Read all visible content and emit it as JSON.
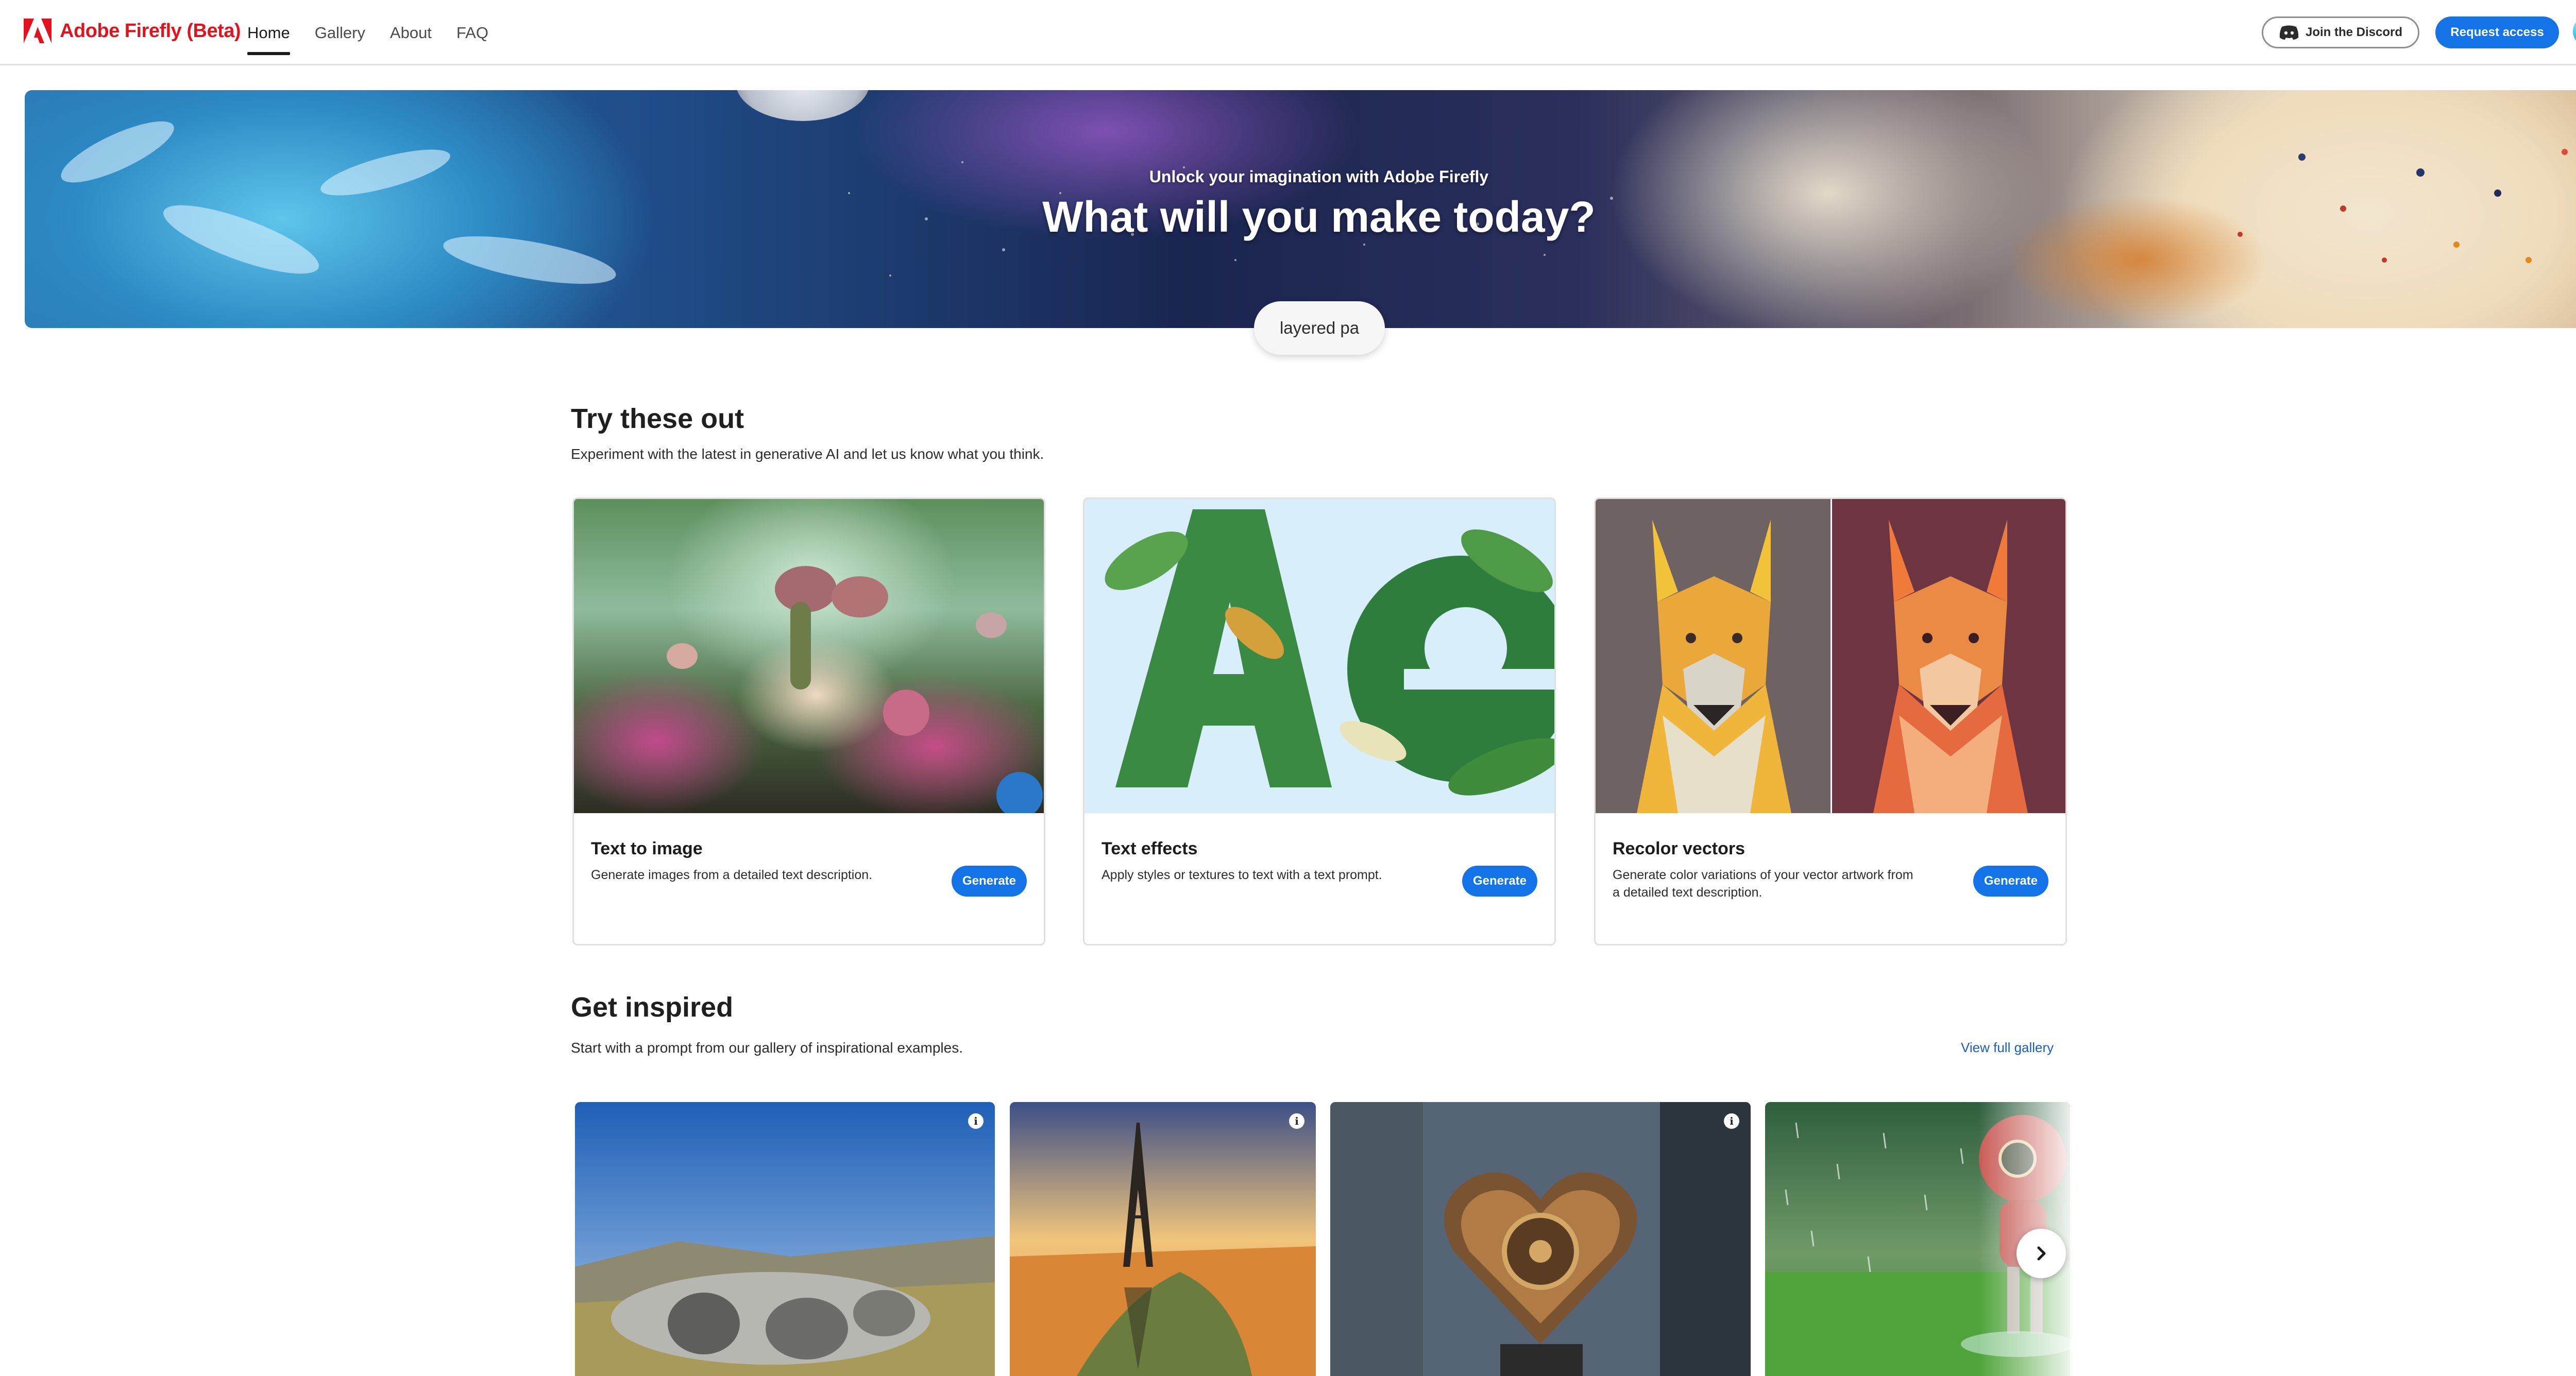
{
  "header": {
    "brand": "Adobe Firefly (Beta)",
    "nav": [
      {
        "label": "Home",
        "active": true
      },
      {
        "label": "Gallery",
        "active": false
      },
      {
        "label": "About",
        "active": false
      },
      {
        "label": "FAQ",
        "active": false
      }
    ],
    "discord_label": "Join the Discord",
    "request_label": "Request access",
    "brand_color": "#e0141e",
    "accent_color": "#1473e6"
  },
  "hero": {
    "subtitle": "Unlock your imagination with Adobe Firefly",
    "title": "What will you make today?",
    "prompt_text": "layered pa"
  },
  "try_section": {
    "title": "Try these out",
    "description": "Experiment with the latest in generative AI and let us know what you think.",
    "cards": [
      {
        "title": "Text to image",
        "description": "Generate images from a detailed text description.",
        "button": "Generate",
        "image": "fantasy-garden-image"
      },
      {
        "title": "Text effects",
        "description": "Apply styles or textures to text with a text prompt.",
        "button": "Generate",
        "image": "leaf-letters-image"
      },
      {
        "title": "Recolor vectors",
        "description": "Generate color variations of your vector artwork from a detailed text description.",
        "button": "Generate",
        "image": "dog-vectors-image"
      }
    ]
  },
  "inspired_section": {
    "title": "Get inspired",
    "description": "Start with a prompt from our gallery of inspirational examples.",
    "view_gallery_label": "View full gallery",
    "images": [
      {
        "subject": "abandoned-spaceship-image",
        "info_icon": "info-icon"
      },
      {
        "subject": "eiffel-tower-desert-image",
        "info_icon": "info-icon"
      },
      {
        "subject": "steampunk-heart-image",
        "info_icon": "info-icon"
      },
      {
        "subject": "robot-in-rain-image",
        "info_icon": "info-icon"
      }
    ],
    "next_icon": "chevron-right-icon"
  }
}
